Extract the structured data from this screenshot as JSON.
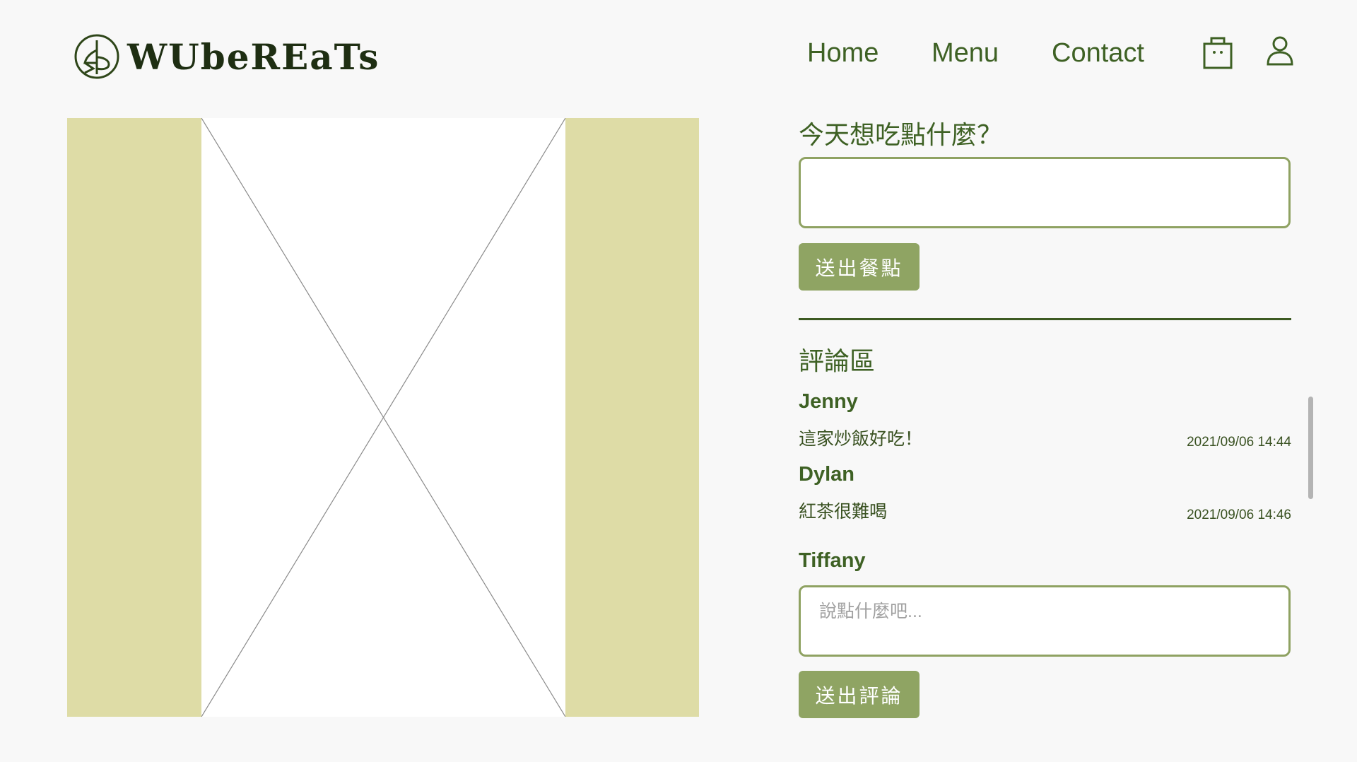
{
  "brand": {
    "name": "WUbeREaTs",
    "color": "#1e2e12"
  },
  "nav": {
    "items": [
      {
        "label": "Home"
      },
      {
        "label": "Menu"
      },
      {
        "label": "Contact"
      }
    ],
    "cart_icon": "shopping-bag-icon",
    "account_icon": "user-icon"
  },
  "hero": {
    "image": "image-placeholder",
    "side_color": "#dedca6"
  },
  "order": {
    "question": "今天想吃點什麼？",
    "input_value": "",
    "submit_label": "送出餐點"
  },
  "comments": {
    "title": "評論區",
    "items": [
      {
        "name": "Jenny",
        "text": "這家炒飯好吃！",
        "time": "2021/09/06  14:44"
      },
      {
        "name": "Dylan",
        "text": "紅茶很難喝",
        "time": "2021/09/06  14:46"
      }
    ],
    "current_user": "Tiffany",
    "input_placeholder": "說點什麼吧...",
    "submit_label": "送出評論"
  },
  "colors": {
    "accent": "#3e6124",
    "button": "#8fa463",
    "border": "#8fa262"
  }
}
